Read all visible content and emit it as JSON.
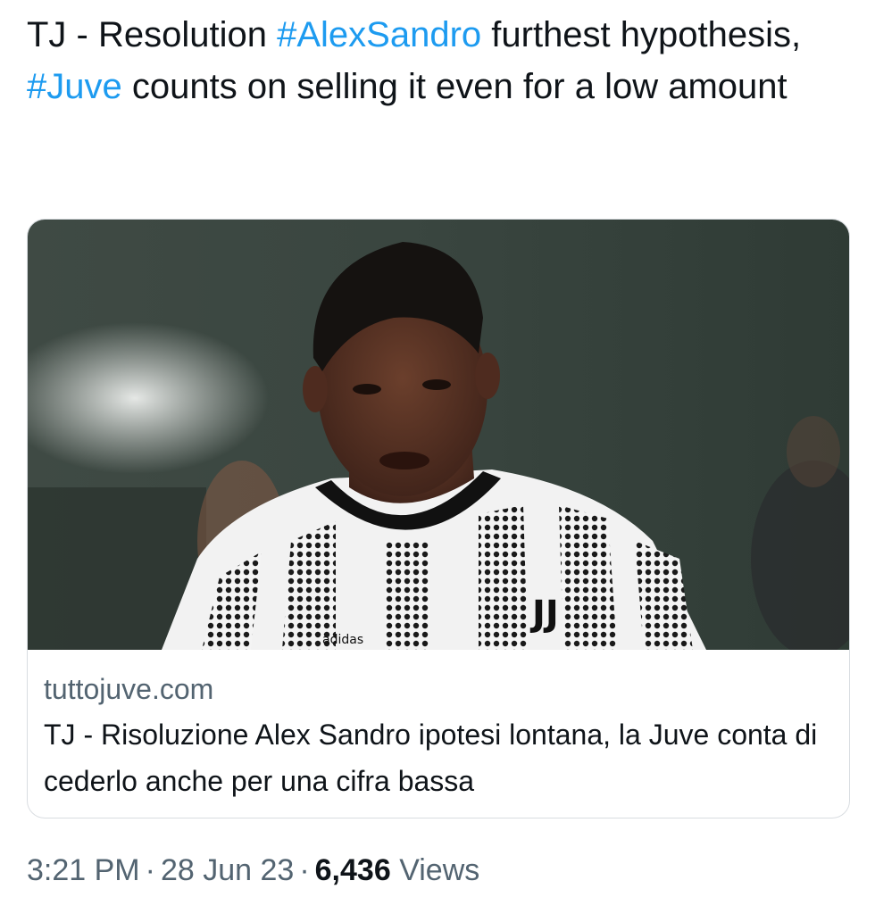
{
  "tweet": {
    "text_before": "TJ - Resolution ",
    "hashtag_1": "#AlexSandro",
    "text_middle": " furthest hypothesis, ",
    "hashtag_2": "#Juve",
    "text_after": " counts on selling it even for a low amount"
  },
  "card": {
    "image_icon": "photo-of-player-in-striped-jersey",
    "jersey_brand_text": "adidas",
    "jersey_crest_text": "JJ",
    "domain": "tuttojuve.com",
    "title": "TJ - Risoluzione Alex Sandro ipotesi lontana, la Juve conta di cederlo anche per una cifra bassa"
  },
  "meta": {
    "time": "3:21 PM",
    "separator": "·",
    "date": "28 Jun 23",
    "views_count": "6,436",
    "views_label": "Views"
  },
  "colors": {
    "text": "#0f1419",
    "secondary": "#536471",
    "link": "#1d9bf0",
    "card_border": "#d9dde1"
  }
}
